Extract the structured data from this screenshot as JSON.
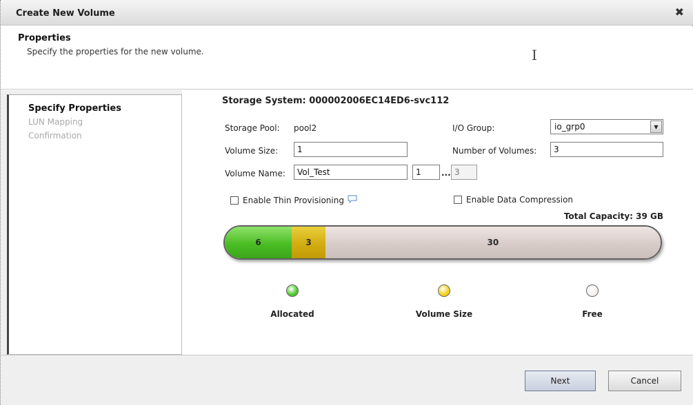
{
  "dialog": {
    "title": "Create New Volume",
    "close_glyph": "✖"
  },
  "header": {
    "title": "Properties",
    "subtitle": "Specify the properties for the new volume."
  },
  "nav": {
    "steps": [
      "Specify Properties",
      "LUN Mapping",
      "Confirmation"
    ],
    "active_index": 0
  },
  "form": {
    "storage_system": "Storage System: 000002006EC14ED6-svc112",
    "storage_pool_label": "Storage Pool:",
    "storage_pool_value": "pool2",
    "io_group_label": "I/O Group:",
    "io_group_value": "io_grp0",
    "volume_size_label": "Volume Size:",
    "volume_size_value": "1",
    "num_volumes_label": "Number of Volumes:",
    "num_volumes_value": "3",
    "volume_name_label": "Volume Name:",
    "volume_name_value": "Vol_Test",
    "name_start_value": "1",
    "name_ellipsis": "...",
    "name_end_value": "3",
    "thin_provisioning_label": "Enable Thin Provisioning",
    "compression_label": "Enable Data Compression"
  },
  "capacity": {
    "total_label": "Total Capacity: 39 GB",
    "segments": [
      {
        "label": "6",
        "value": 6,
        "color": "#4cbd25"
      },
      {
        "label": "3",
        "value": 3,
        "color": "#d2ad12"
      },
      {
        "label": "30",
        "value": 30,
        "color": "#d8ccc9"
      }
    ],
    "legend": [
      {
        "name": "Allocated",
        "color": "#4cc82a"
      },
      {
        "name": "Volume Size",
        "color": "#f0d212"
      },
      {
        "name": "Free",
        "color": "#f3f0ee"
      }
    ]
  },
  "footer": {
    "next_label": "Next",
    "cancel_label": "Cancel"
  },
  "icons": [
    "close-icon",
    "ibeam-cursor-icon",
    "dropdown-arrow-icon",
    "help-bubble-icon"
  ]
}
